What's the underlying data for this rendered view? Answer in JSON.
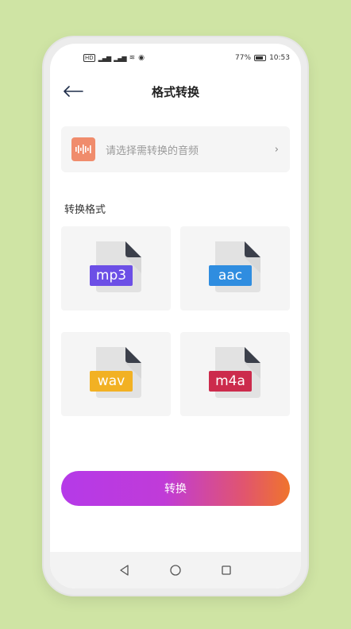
{
  "status_bar": {
    "network": "HD",
    "battery_percent": "77%",
    "time": "10:53"
  },
  "header": {
    "title": "格式转换",
    "back_icon": "arrow-left-icon"
  },
  "select_audio": {
    "placeholder": "请选择需转换的音频",
    "icon": "audio-wave-icon",
    "chevron": "›",
    "icon_color": "#f08c6c"
  },
  "section": {
    "label": "转换格式"
  },
  "formats": [
    {
      "label": "mp3",
      "color": "#6c4fe6"
    },
    {
      "label": "aac",
      "color": "#2f8de0"
    },
    {
      "label": "wav",
      "color": "#f2b123"
    },
    {
      "label": "m4a",
      "color": "#cc2b4c"
    }
  ],
  "convert_button": {
    "label": "转换",
    "gradient_start": "#b53ae8",
    "gradient_end": "#f0742c"
  },
  "nav": {
    "back": "◁",
    "home": "○",
    "recent": "□"
  }
}
